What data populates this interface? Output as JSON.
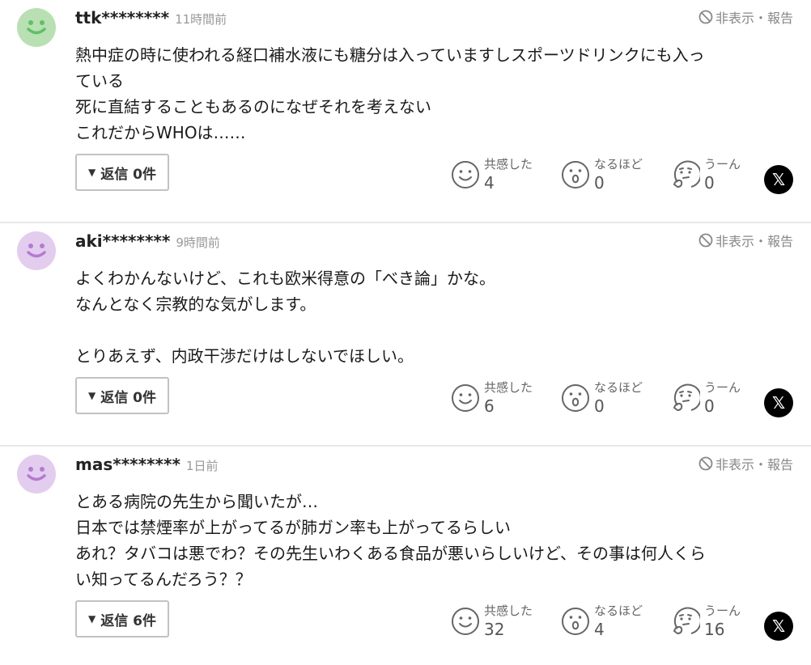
{
  "labels": {
    "hide_report": "非表示・報告",
    "reaction_empathy": "共感した",
    "reaction_insight": "なるほど",
    "reaction_hmm": "うーん",
    "x_icon": "𝕏"
  },
  "comments": [
    {
      "username": "ttk********",
      "timestamp": "11時間前",
      "avatar_color": "#b9e0b2",
      "avatar_face_color": "#5fbf6a",
      "lines": [
        "熱中症の時に使われる経口補水液にも糖分は入っていますしスポーツドリンクにも入っ",
        "ている",
        "死に直結することもあるのになぜそれを考えない",
        "これだからWHOは……"
      ],
      "reply_label": "返信 0件",
      "empathy_count": "4",
      "insight_count": "0",
      "hmm_count": "0"
    },
    {
      "username": "aki********",
      "timestamp": "9時間前",
      "avatar_color": "#e3cdee",
      "avatar_face_color": "#b47ad2",
      "lines": [
        "よくわかんないけど、これも欧米得意の「べき論」かな。",
        "なんとなく宗教的な気がします。",
        "",
        "とりあえず、内政干渉だけはしないでほしい。"
      ],
      "reply_label": "返信 0件",
      "empathy_count": "6",
      "insight_count": "0",
      "hmm_count": "0"
    },
    {
      "username": "mas********",
      "timestamp": "1日前",
      "avatar_color": "#e3cdee",
      "avatar_face_color": "#b47ad2",
      "lines": [
        "とある病院の先生から聞いたが…",
        "日本では禁煙率が上がってるが肺ガン率も上がってるらしい",
        "あれ？タバコは悪でわ？その先生いわくある食品が悪いらしいけど、その事は何人くら",
        "い知ってるんだろう？？"
      ],
      "reply_label": "返信 6件",
      "empathy_count": "32",
      "insight_count": "4",
      "hmm_count": "16"
    }
  ]
}
